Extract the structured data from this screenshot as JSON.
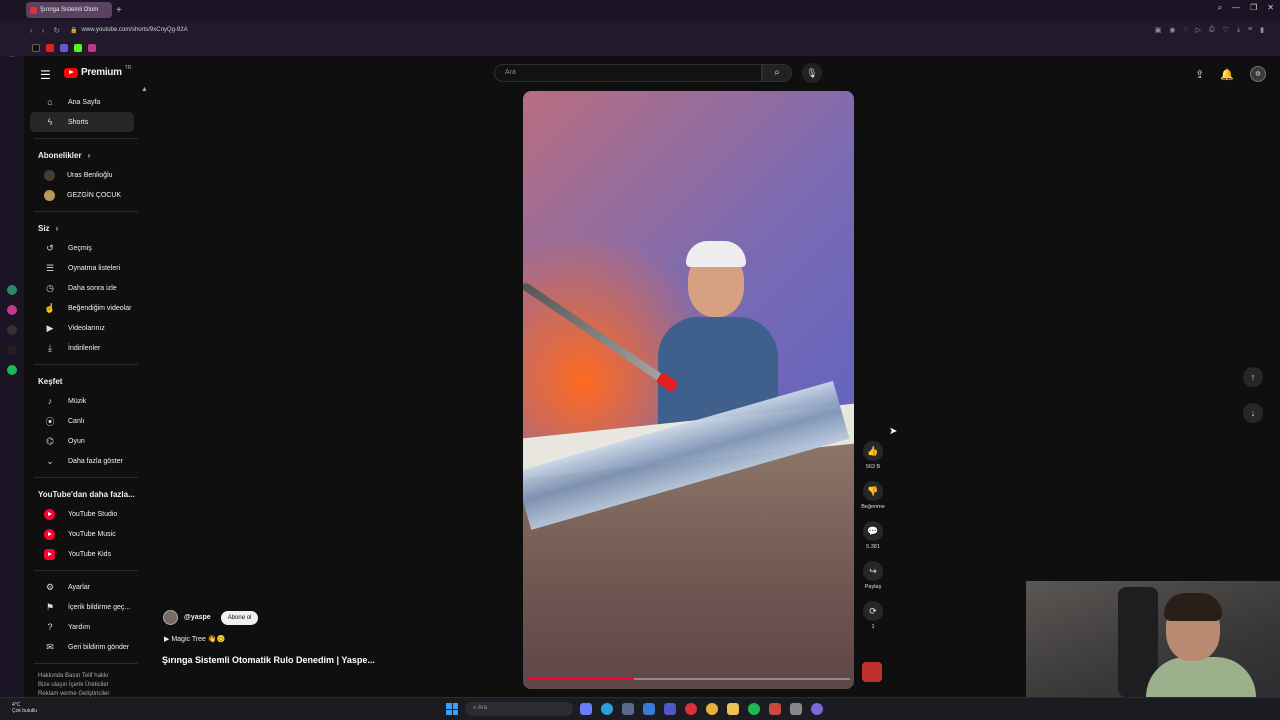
{
  "browser": {
    "tab_title": "Şırınga Sistemli Otom",
    "new_tab": "+",
    "url": "www.youtube.com/shorts/9xCnyQg-92A"
  },
  "header": {
    "logo_text": "Premium",
    "country_code": "TR",
    "search_placeholder": "Ara"
  },
  "sidebar": {
    "top": [
      {
        "label": "Ana Sayfa",
        "icon": "home-icon",
        "glyph": "⌂"
      },
      {
        "label": "Shorts",
        "icon": "shorts-icon",
        "glyph": "ϟ"
      }
    ],
    "subs_heading": "Abonelikler",
    "subs": [
      {
        "label": "Uras Benlioğlu",
        "color": "#4a3a34"
      },
      {
        "label": "GEZGİN ÇOCUK",
        "color": "#b59a5a"
      }
    ],
    "you_heading": "Siz",
    "you": [
      {
        "label": "Geçmiş",
        "icon": "history-icon",
        "glyph": "↺"
      },
      {
        "label": "Oynatma listeleri",
        "icon": "playlist-icon",
        "glyph": "☰"
      },
      {
        "label": "Daha sonra izle",
        "icon": "clock-icon",
        "glyph": "◷"
      },
      {
        "label": "Beğendiğim videolar",
        "icon": "like-icon",
        "glyph": "👍"
      },
      {
        "label": "Videolarınız",
        "icon": "your-videos-icon",
        "glyph": "▶"
      },
      {
        "label": "İndirilenler",
        "icon": "download-icon",
        "glyph": "⤓"
      }
    ],
    "explore_heading": "Keşfet",
    "explore": [
      {
        "label": "Müzik",
        "icon": "music-icon",
        "glyph": "♪"
      },
      {
        "label": "Canlı",
        "icon": "live-icon",
        "glyph": "((•))"
      },
      {
        "label": "Oyun",
        "icon": "game-icon",
        "glyph": "⌬"
      },
      {
        "label": "Daha fazla göster",
        "icon": "chevron-down-icon",
        "glyph": "⌄"
      }
    ],
    "more_heading": "YouTube'dan daha fazla...",
    "more": [
      {
        "label": "YouTube Studio"
      },
      {
        "label": "YouTube Music"
      },
      {
        "label": "YouTube Kids"
      }
    ],
    "settings": [
      {
        "label": "Ayarlar",
        "icon": "gear-icon",
        "glyph": "⚙"
      },
      {
        "label": "İçerik bildirme geç...",
        "icon": "flag-icon",
        "glyph": "⚑"
      },
      {
        "label": "Yardım",
        "icon": "help-icon",
        "glyph": "?"
      },
      {
        "label": "Geri bildirim gönder",
        "icon": "feedback-icon",
        "glyph": "✉"
      }
    ],
    "footer_line1": "Hakkında  Basın  Telif hakkı",
    "footer_line2": "Bize ulaşın  İçerik Üreticiler",
    "footer_line3": "Reklam verme  Geliştiriciler"
  },
  "video": {
    "channel": "@yaspe",
    "subscribe_label": "Abone ol",
    "music": "Magic Tree 👋😊",
    "title": "Şırınga Sistemli Otomatik Rulo Denedim | Yaspe...",
    "progress": 0.33
  },
  "actions": {
    "like_count": "563 B",
    "dislike_label": "Beğenme",
    "comment_count": "5.381",
    "share_label": "Paylaş",
    "remix_count": "1"
  },
  "taskbar": {
    "weather_temp": "4°C",
    "weather_desc": "Çok bulutlu",
    "search": "Ara"
  }
}
